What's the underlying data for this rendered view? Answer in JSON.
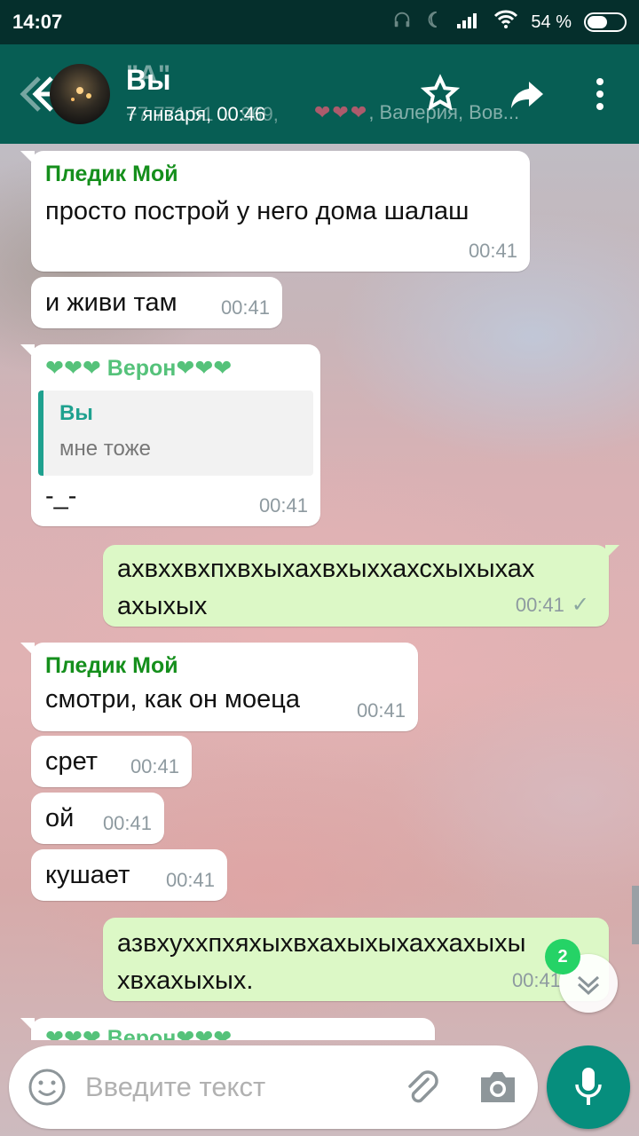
{
  "status_bar": {
    "time": "14:07",
    "battery": "54 %",
    "battery_level": 0.54
  },
  "header": {
    "title": "Вы",
    "ghost_title": "\"А\"",
    "subtitle": "7 января, 00:46",
    "ghost_subtitle": "+7 771 51 ... 969,",
    "ghost_members_hearts": "❤❤❤",
    "ghost_members_names": ", Валерия, Вов..."
  },
  "messages": [
    {
      "sender": "Пледик Мой",
      "text": "просто построй у него дома шалаш",
      "time": "00:41"
    },
    {
      "text": "и живи там",
      "time": "00:41"
    },
    {
      "sender": "❤❤❤ Верон❤❤❤",
      "quote_name": "Вы",
      "quote_text": "мне тоже",
      "text": "-_-",
      "time": "00:41"
    },
    {
      "outgoing": true,
      "line1": "ахвххвхпхвхыхахвхыххахсхыхыхах",
      "line2": "ахыхых",
      "time": "00:41",
      "tick": "✓"
    },
    {
      "sender": "Пледик Мой",
      "text": "смотри, как он моеца",
      "time": "00:41"
    },
    {
      "text": "срет",
      "time": "00:41"
    },
    {
      "text": "ой",
      "time": "00:41"
    },
    {
      "text": "кушает",
      "time": "00:41"
    },
    {
      "outgoing": true,
      "line1": "азвхуххпхяхыхвхахыхыхаххахыхы",
      "line2": "хвхахыхых.",
      "time": "00:41"
    },
    {
      "sender": "❤❤❤ Верон❤❤❤"
    }
  ],
  "scroll": {
    "unread_count": "2"
  },
  "composer": {
    "placeholder": "Введите текст"
  },
  "colors": {
    "app_bar": "#075e54",
    "status_bar": "#052f2c",
    "outgoing": "#dcf8c6",
    "accent": "#068e7d"
  }
}
